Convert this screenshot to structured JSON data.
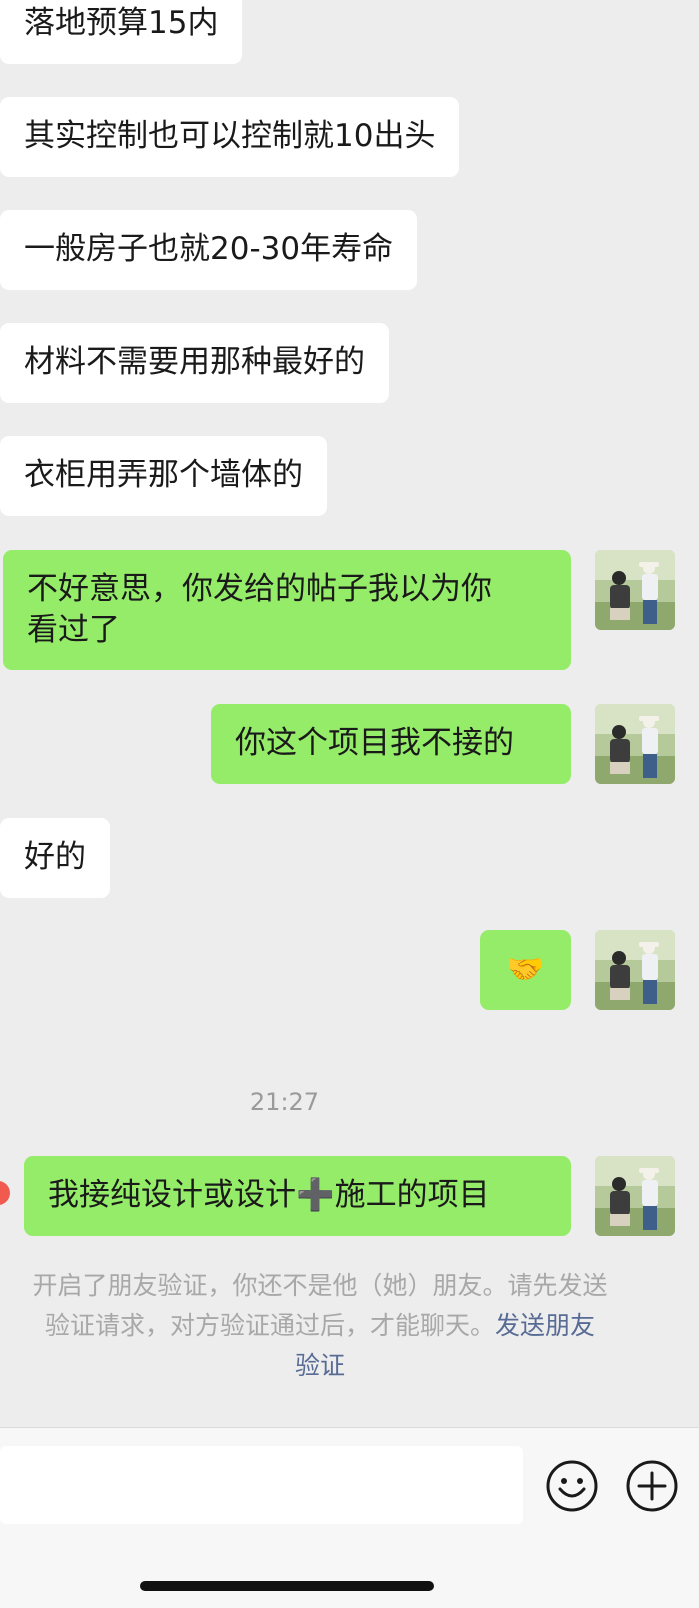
{
  "messages": [
    {
      "side": "in",
      "text": "落地预算15内"
    },
    {
      "side": "in",
      "text": "其实控制也可以控制就10出头"
    },
    {
      "side": "in",
      "text": "一般房子也就20-30年寿命"
    },
    {
      "side": "in",
      "text": "材料不需要用那种最好的"
    },
    {
      "side": "in",
      "text": "衣柜用弄那个墙体的"
    },
    {
      "side": "out",
      "line1": "不好意思，你发给的帖子我以为你",
      "line2": "看过了"
    },
    {
      "side": "out",
      "text": "你这个项目我不接的"
    },
    {
      "side": "in",
      "text": "好的"
    },
    {
      "side": "out",
      "text": "🤝",
      "icon": "handshake-icon"
    },
    {
      "side": "out",
      "text": "我接纯设计或设计➕施工的项目",
      "status": "send-failed"
    }
  ],
  "timestamp": "21:27",
  "notice": {
    "line1": "开启了朋友验证，你还不是他（她）朋友。请先发送",
    "line2_text": "验证请求，对方验证通过后，才能聊天。",
    "link_part1": "发送朋友",
    "link_part2": "验证"
  },
  "input_bar": {
    "input_value": "",
    "emoji_icon": "emoji-icon",
    "plus_icon": "plus-icon"
  },
  "colors": {
    "background": "#ededed",
    "incoming_bubble": "#ffffff",
    "outgoing_bubble": "#95ec69",
    "link": "#576b95",
    "error": "#f05a4f"
  }
}
